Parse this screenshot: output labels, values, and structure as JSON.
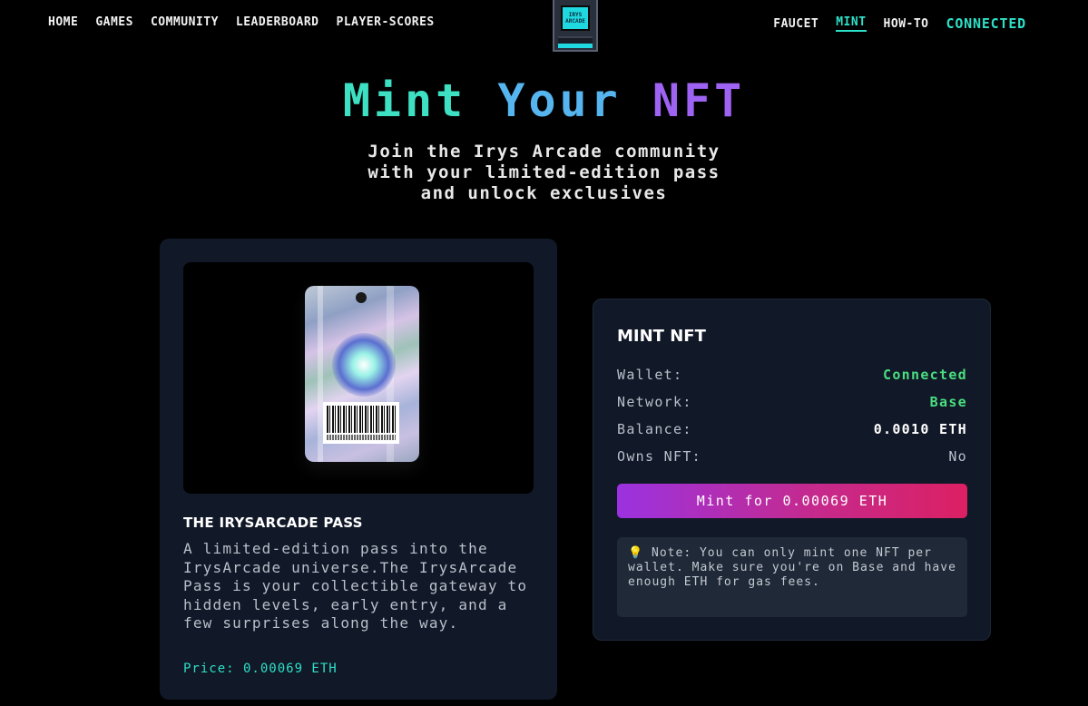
{
  "nav": {
    "left": [
      "HOME",
      "GAMES",
      "COMMUNITY",
      "LEADERBOARD",
      "PLAYER-SCORES"
    ],
    "right": [
      "FAUCET",
      "MINT",
      "HOW-TO"
    ],
    "active": "MINT",
    "connect_label": "CONNECTED",
    "logo_line1": "IRYS",
    "logo_line2": "ARCADE"
  },
  "hero": {
    "title_word1": "Mint",
    "title_word2": "Your",
    "title_word3": "NFT",
    "subtitle_line1": "Join the Irys Arcade community",
    "subtitle_line2": "with your limited-edition pass",
    "subtitle_line3": "and unlock exclusives"
  },
  "nft": {
    "name": "THE IRYSARCADE PASS",
    "description": "A limited-edition pass into the IrysArcade universe.The IrysArcade Pass is your collectible gateway to hidden levels, early entry, and a few surprises along the way.",
    "price": "Price: 0.00069 ETH"
  },
  "mint": {
    "title": "MINT NFT",
    "rows": [
      {
        "label": "Wallet:",
        "value": "Connected"
      },
      {
        "label": "Network:",
        "value": "Base"
      },
      {
        "label": "Balance:",
        "value": "0.0010 ETH"
      },
      {
        "label": "Owns NFT:",
        "value": "No"
      }
    ],
    "button_label": "Mint for 0.00069 ETH",
    "note_icon": "💡",
    "note": "Note: You can only mint one NFT per wallet. Make sure you're on Base and have enough ETH for gas fees."
  },
  "colors": {
    "accent_teal": "#2de0c8",
    "title_blue": "#56b4ef",
    "title_purple": "#9e63f2",
    "status_green": "#4ade80",
    "card_bg": "#111827"
  }
}
